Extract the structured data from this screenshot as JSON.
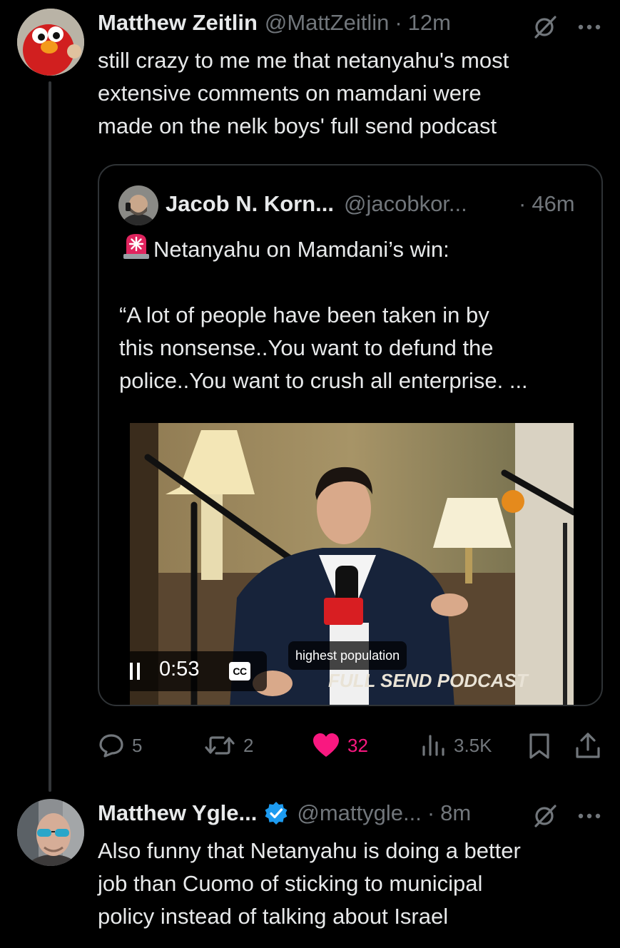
{
  "tweet1": {
    "display_name": "Matthew Zeitlin",
    "handle": "@MattZeitlin",
    "separator": "·",
    "time": "12m",
    "text": "still crazy to me me that netanyahu's most\nextensive comments on mamdani were\nmade on the nelk boys' full send podcast",
    "more_icon": "more-dots-icon",
    "grok_icon": "grok-icon"
  },
  "quote": {
    "display_name": "Jacob N. Korn...",
    "handle": "@jacobkor...",
    "separator": "·",
    "time": "46m",
    "emoji_icon": "siren-icon",
    "line1": "Netanyahu on Mamdani’s win:",
    "body": "“A lot of people have been taken in by\nthis nonsense..You want to defund the\npolice..You want to crush all enterprise. ...",
    "video": {
      "state": "playing",
      "timestamp": "0:53",
      "caption": "highest population",
      "cc_label": "CC",
      "overlay_logo_text": "FULL SEND PODCAST"
    }
  },
  "actions": {
    "replies": "5",
    "reposts": "2",
    "likes": "32",
    "views": "3.5K",
    "liked": true,
    "like_color": "#f91880",
    "muted_color": "#71767b"
  },
  "tweet2": {
    "display_name": "Matthew Ygle...",
    "verified": true,
    "verified_color": "#1d9bf0",
    "handle": "@mattygle...",
    "separator": "·",
    "time": "8m",
    "text": "Also funny that Netanyahu is doing a better\njob than Cuomo of sticking to municipal\npolicy instead of talking about Israel"
  }
}
